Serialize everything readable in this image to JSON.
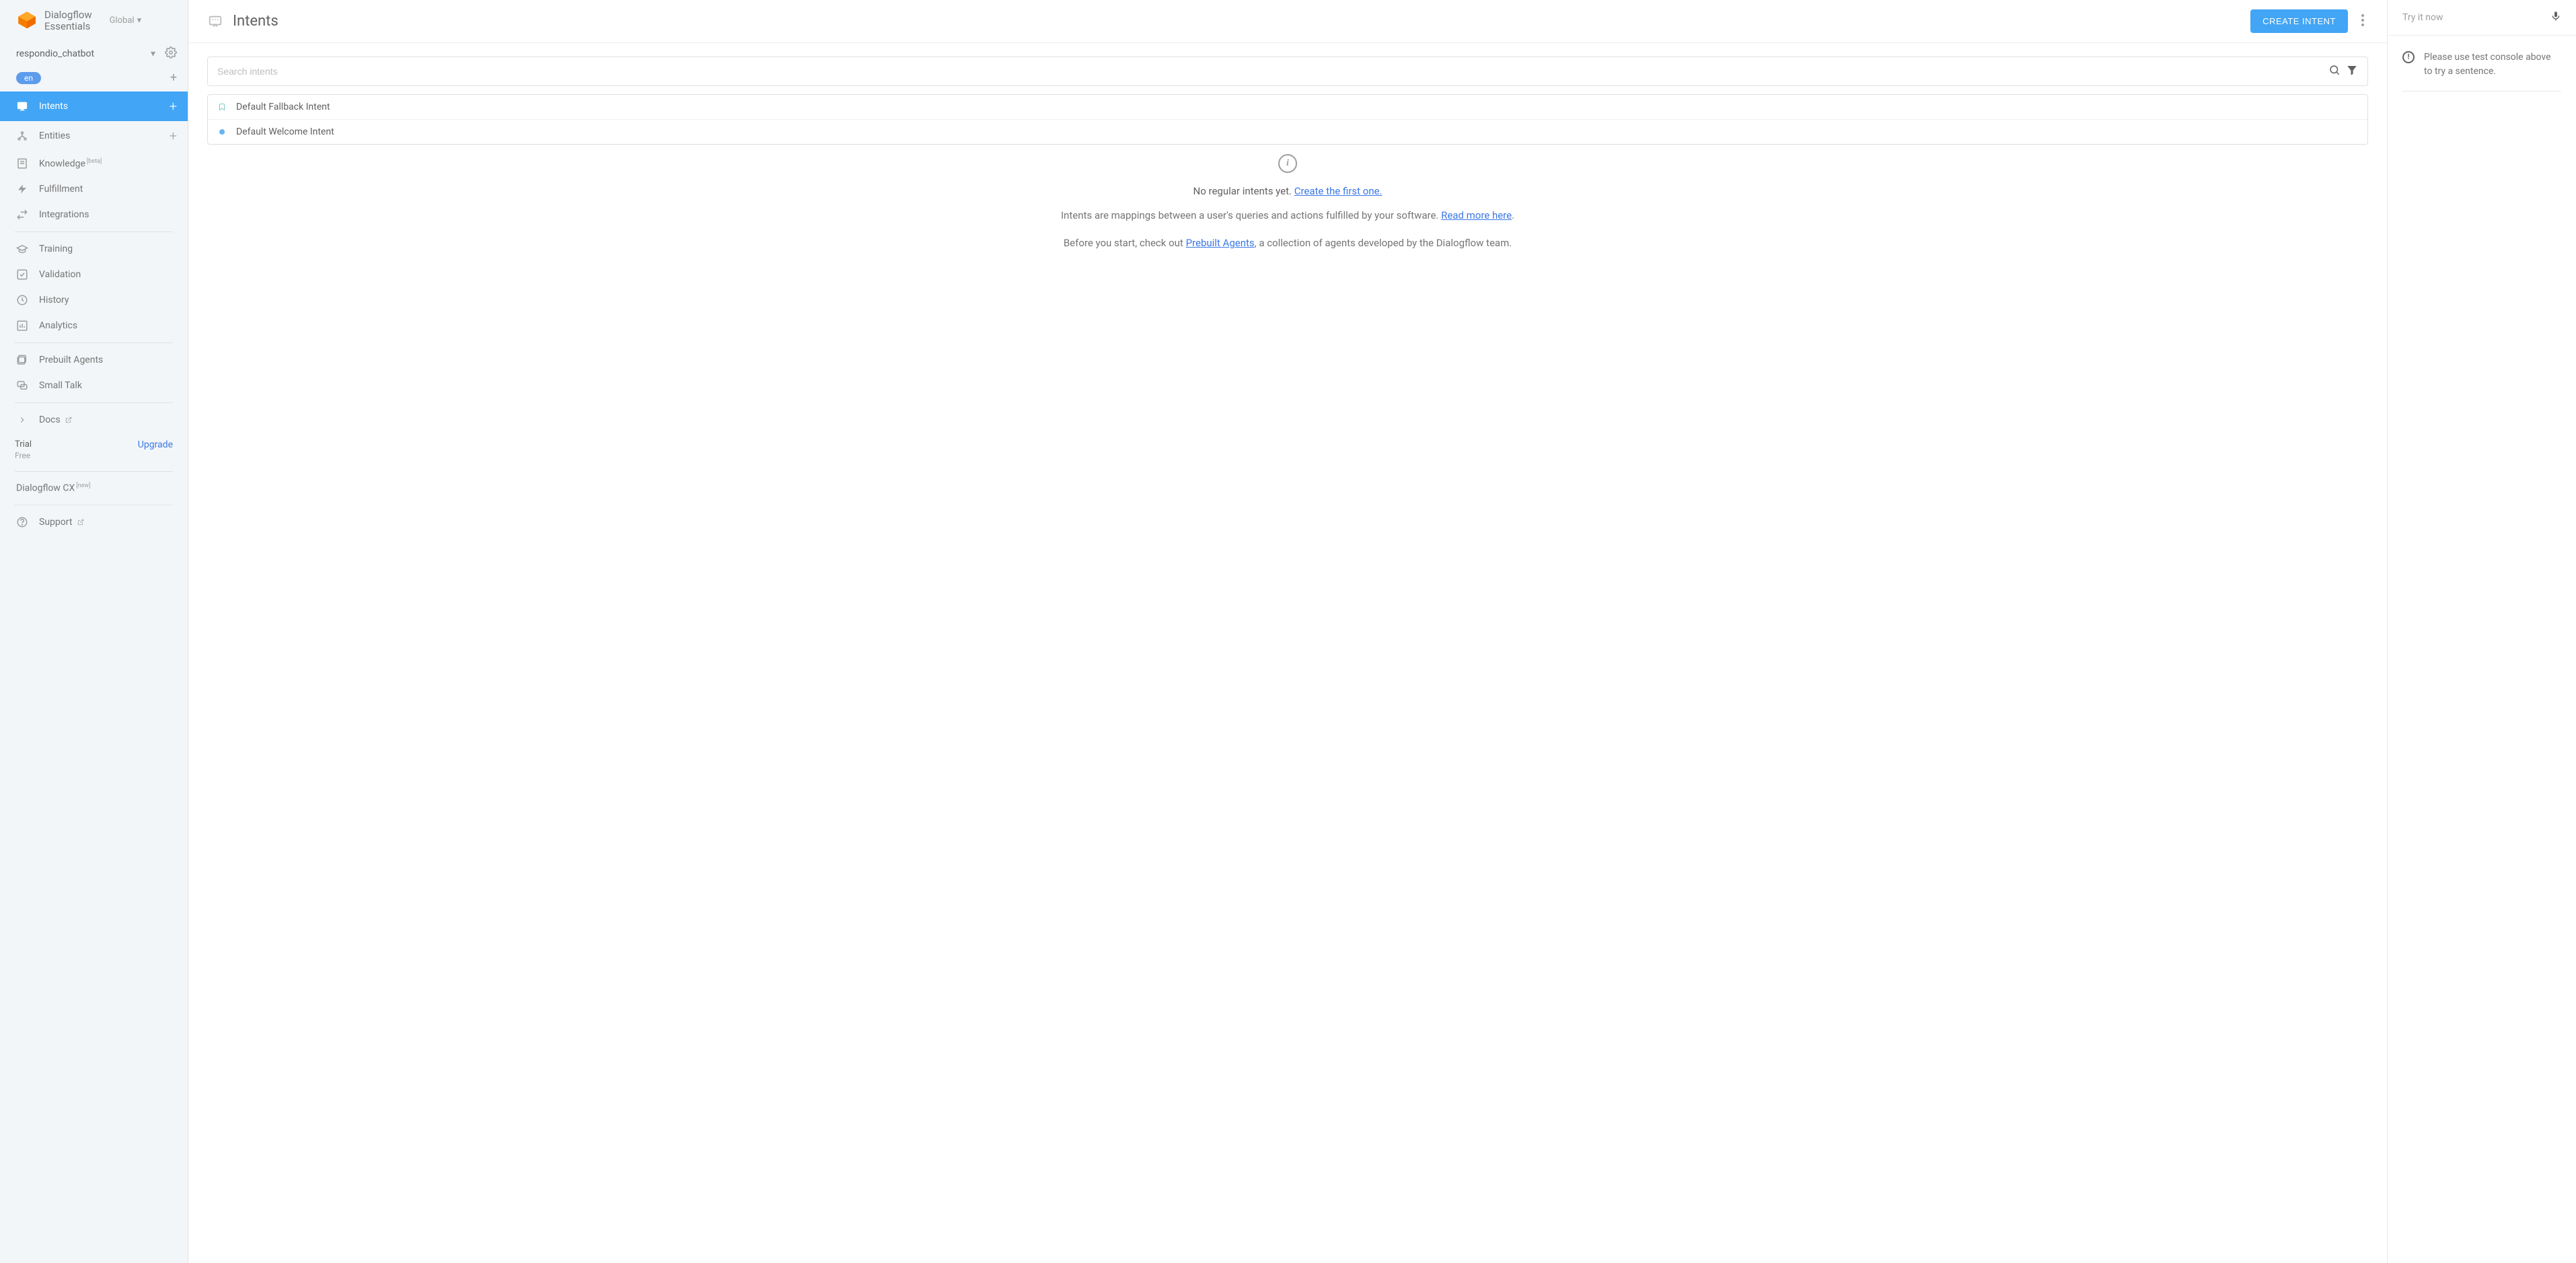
{
  "header": {
    "product_line1": "Dialogflow",
    "product_line2": "Essentials",
    "global_label": "Global"
  },
  "agent": {
    "name": "respondio_chatbot",
    "language_badge": "en"
  },
  "nav": {
    "intents": "Intents",
    "entities": "Entities",
    "knowledge": "Knowledge",
    "knowledge_tag": "[beta]",
    "fulfillment": "Fulfillment",
    "integrations": "Integrations",
    "training": "Training",
    "validation": "Validation",
    "history": "History",
    "analytics": "Analytics",
    "prebuilt_agents": "Prebuilt Agents",
    "small_talk": "Small Talk",
    "docs": "Docs",
    "trial_title": "Trial",
    "trial_sub": "Free",
    "upgrade": "Upgrade",
    "cx_label": "Dialogflow CX",
    "cx_tag": "[new]",
    "support": "Support"
  },
  "main": {
    "title": "Intents",
    "create_button": "CREATE INTENT",
    "search_placeholder": "Search intents",
    "intents": [
      {
        "name": "Default Fallback Intent",
        "type": "fallback"
      },
      {
        "name": "Default Welcome Intent",
        "type": "welcome"
      }
    ],
    "empty": {
      "head_prefix": "No regular intents yet. ",
      "head_link": "Create the first one.",
      "p1_a": "Intents are mappings between a user's queries and actions fulfilled by your software. ",
      "p1_link": "Read more here",
      "p1_b": ".",
      "p2_a": "Before you start, check out ",
      "p2_link": "Prebuilt Agents",
      "p2_b": ", a collection of agents developed by the Dialogflow team."
    }
  },
  "test": {
    "placeholder": "Try it now",
    "info": "Please use test console above to try a sentence."
  }
}
